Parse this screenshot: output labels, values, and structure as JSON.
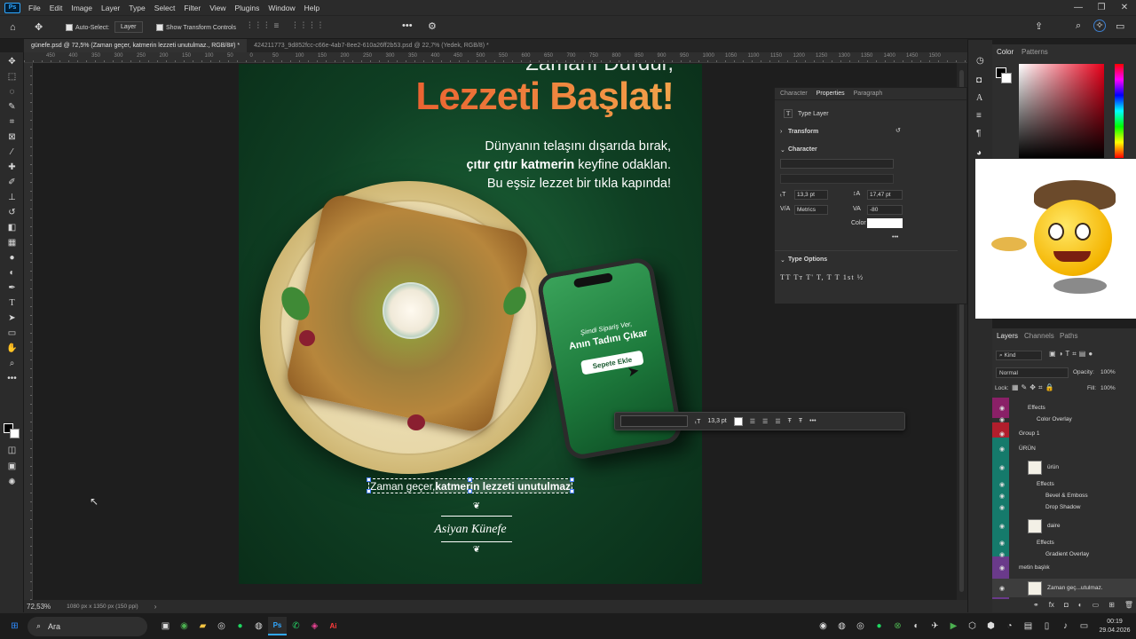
{
  "app": {
    "logo": "Ps"
  },
  "menu": [
    "File",
    "Edit",
    "Image",
    "Layer",
    "Type",
    "Select",
    "Filter",
    "View",
    "Plugins",
    "Window",
    "Help"
  ],
  "options_bar": {
    "auto_select_label": "Auto-Select:",
    "auto_select_value": "Layer",
    "show_transform_label": "Show Transform Controls"
  },
  "tabs": [
    {
      "label": "günefe.psd @ 72,5% (Zaman geçer, katmerin lezzeti unutulmaz., RGB/8#) *",
      "active": true
    },
    {
      "label": "424211773_9d852fcc-c66e-4ab7-8ee2-610a26ff2b53.psd @ 22,7% (Yedek, RGB/8) *",
      "active": false
    }
  ],
  "ruler_labels": [
    "450",
    "400",
    "350",
    "300",
    "250",
    "200",
    "150",
    "100",
    "50",
    "0",
    "50",
    "100",
    "150",
    "200",
    "250",
    "300",
    "350",
    "400",
    "450",
    "500",
    "550",
    "600",
    "650",
    "700",
    "750",
    "800",
    "850",
    "900",
    "950",
    "1000",
    "1050",
    "1100",
    "1150",
    "1200",
    "1250",
    "1300",
    "1350",
    "1400",
    "1450",
    "1500"
  ],
  "artboard": {
    "header_top": "Zamanı Durdur,",
    "header_main": "Lezzeti Başlat!",
    "sub1": "Dünyanın telaşını dışarıda bırak,",
    "sub2_bold": "çıtır çıtır katmerin",
    "sub2_rest": " keyfine odaklan.",
    "sub3": "Bu eşsiz lezzet bir tıkla kapında!",
    "phone_line1": "Şimdi Sipariş Ver,",
    "phone_line2": "Anın Tadını Çıkar",
    "phone_button": "Sepete Ekle",
    "selected_text_a": "Zaman geçer, ",
    "selected_text_b": "katmerin lezzeti unutulmaz.",
    "logo": "Asiyan Künefe"
  },
  "context_bar": {
    "size": "13,3 pt"
  },
  "properties": {
    "tabs": [
      "Character",
      "Properties",
      "Paragraph"
    ],
    "active_tab": "Properties",
    "layer_type": "Type Layer",
    "transform_label": "Transform",
    "character_label": "Character",
    "font_size": "13,3 pt",
    "leading": "17,47 pt",
    "kerning": "Metrics",
    "tracking": "-80",
    "color_label": "Color",
    "type_options_label": "Type Options",
    "type_options_glyphs": "TT Tт T' T, T T 1st ½"
  },
  "color_panel": {
    "tabs": [
      "Color",
      "Patterns"
    ]
  },
  "layers": {
    "tabs": [
      "Layers",
      "Channels",
      "Paths"
    ],
    "filter_kind": "Kind",
    "blend_mode": "Normal",
    "opacity_label": "Opacity:",
    "opacity": "100%",
    "lock_label": "Lock:",
    "fill_label": "Fill:",
    "fill": "100%",
    "rows": [
      {
        "name": "Effects",
        "indent": 1,
        "eye": true
      },
      {
        "name": "Color Overlay",
        "indent": 2,
        "eye": true
      },
      {
        "name": "Group 1",
        "indent": 0,
        "eye": true
      },
      {
        "name": "ÜRÜN",
        "indent": 0,
        "eye": true
      },
      {
        "name": "ürün",
        "indent": 1,
        "eye": true,
        "thumb": true
      },
      {
        "name": "Effects",
        "indent": 2,
        "eye": true
      },
      {
        "name": "Bevel & Emboss",
        "indent": 3,
        "eye": true
      },
      {
        "name": "Drop Shadow",
        "indent": 3,
        "eye": true
      },
      {
        "name": "daire",
        "indent": 1,
        "eye": true,
        "thumb": true
      },
      {
        "name": "Effects",
        "indent": 2,
        "eye": true
      },
      {
        "name": "Gradient Overlay",
        "indent": 3,
        "eye": true
      },
      {
        "name": "metin başlık",
        "indent": 0,
        "eye": true
      },
      {
        "name": "Zaman geç...utulmaz.",
        "indent": 1,
        "eye": true,
        "thumb": true
      }
    ]
  },
  "status": {
    "zoom": "72,53%",
    "doc": "1080 px x 1350 px (150 ppi)"
  },
  "taskbar": {
    "search": "Ara",
    "time": "00:19",
    "date": "29.04.2026"
  }
}
